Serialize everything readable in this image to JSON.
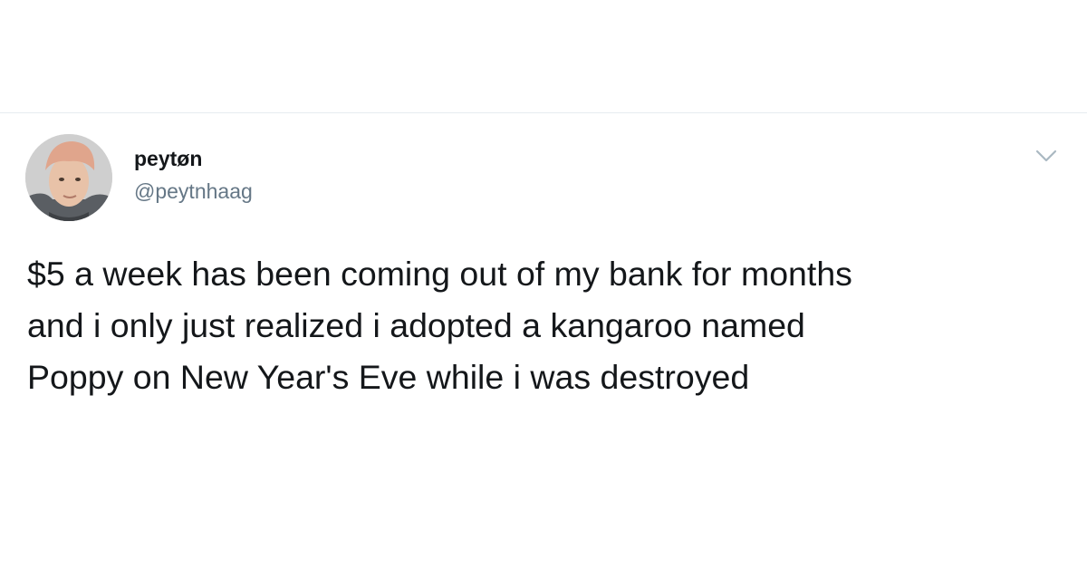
{
  "tweet": {
    "display_name": "peytøn",
    "handle": "@peytnhaag",
    "text": "$5 a week has been coming out of my bank for months\nand i only just realized i adopted a kangaroo named\nPoppy on New Year's Eve while i was destroyed",
    "menu_icon": "chevron-down-icon",
    "avatar_icon": "profile-photo"
  },
  "colors": {
    "name": "#14171a",
    "handle": "#657786",
    "chevron": "#aab8c2",
    "divider": "#e6ecf0",
    "avatar_hat": "#e0a58c"
  }
}
